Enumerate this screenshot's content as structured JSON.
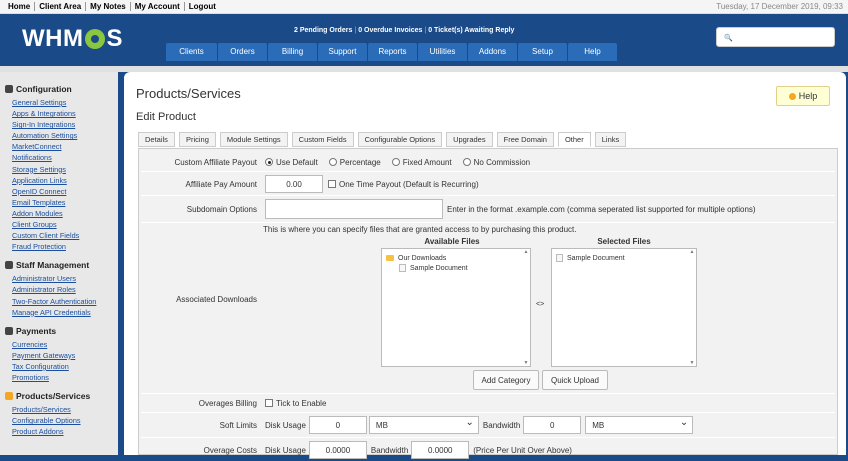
{
  "topbar": {
    "links": [
      "Home",
      "Client Area",
      "My Notes",
      "My Account",
      "Logout"
    ],
    "date": "Tuesday, 17 December 2019, 09:33"
  },
  "logo": {
    "text_a": "WHM",
    "text_b": "S"
  },
  "notices": {
    "orders": "2 Pending Orders",
    "invoices": "0 Overdue Invoices",
    "tickets": "0 Ticket(s) Awaiting Reply"
  },
  "nav": [
    "Clients",
    "Orders",
    "Billing",
    "Support",
    "Reports",
    "Utilities",
    "Addons",
    "Setup",
    "Help"
  ],
  "sidebar": {
    "config_title": "Configuration",
    "config_items": [
      "General Settings",
      "Apps & Integrations",
      "Sign-In Integrations",
      "Automation Settings",
      "MarketConnect",
      "Notifications",
      "Storage Settings",
      "Application Links",
      "OpenID Connect",
      "Email Templates",
      "Addon Modules",
      "Client Groups",
      "Custom Client Fields",
      "Fraud Protection"
    ],
    "staff_title": "Staff Management",
    "staff_items": [
      "Administrator Users",
      "Administrator Roles",
      "Two-Factor Authentication",
      "Manage API Credentials"
    ],
    "pay_title": "Payments",
    "pay_items": [
      "Currencies",
      "Payment Gateways",
      "Tax Configuration",
      "Promotions"
    ],
    "prod_title": "Products/Services",
    "prod_items": [
      "Products/Services",
      "Configurable Options",
      "Product Addons"
    ]
  },
  "page": {
    "title": "Products/Services",
    "help": "Help",
    "subtitle": "Edit Product"
  },
  "tabs": [
    "Details",
    "Pricing",
    "Module Settings",
    "Custom Fields",
    "Configurable Options",
    "Upgrades",
    "Free Domain",
    "Other",
    "Links"
  ],
  "form": {
    "affiliate_label": "Custom Affiliate Payout",
    "affiliate_opts": [
      "Use Default",
      "Percentage",
      "Fixed Amount",
      "No Commission"
    ],
    "pay_amount_label": "Affiliate Pay Amount",
    "pay_amount_value": "0.00",
    "one_time": "One Time Payout (Default is Recurring)",
    "subdomain_label": "Subdomain Options",
    "subdomain_value": "",
    "subdomain_hint": "Enter in the format .example.com (comma seperated list supported for multiple options)",
    "downloads_label": "Associated Downloads",
    "downloads_intro": "This is where you can specify files that are granted access to by purchasing this product.",
    "available_title": "Available Files",
    "selected_title": "Selected Files",
    "folder": "Our Downloads",
    "avail_doc": "Sample Document",
    "sel_doc": "Sample Document",
    "move": "<>",
    "add_category": "Add Category",
    "quick_upload": "Quick Upload",
    "overages_label": "Overages Billing",
    "tick_enable": "Tick to Enable",
    "soft_label": "Soft Limits",
    "disk_usage": "Disk Usage",
    "disk_value": "0",
    "disk_unit": "MB",
    "bandwidth": "Bandwidth",
    "bw_value": "0",
    "bw_unit": "MB",
    "costs_label": "Overage Costs",
    "cost_disk_value": "0.0000",
    "cost_bw_value": "0.0000",
    "cost_hint": "(Price Per Unit Over Above)"
  }
}
